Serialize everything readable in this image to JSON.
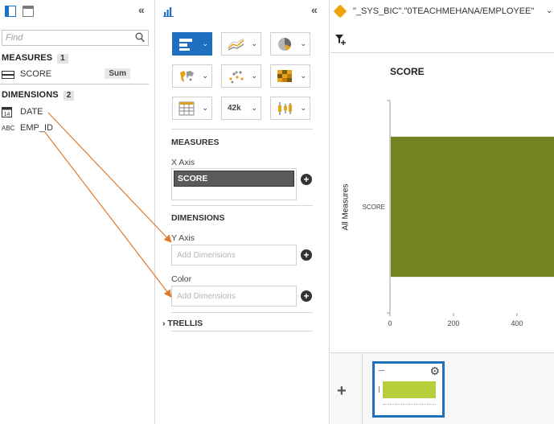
{
  "left_panel": {
    "find_placeholder": "Find",
    "measures_header": "MEASURES",
    "measures_count": "1",
    "measures": [
      {
        "label": "SCORE",
        "aggregation": "Sum",
        "icon": "measure-icon"
      }
    ],
    "dimensions_header": "DIMENSIONS",
    "dimensions_count": "2",
    "dimensions": [
      {
        "label": "DATE",
        "icon": "calendar-icon",
        "icon_text": "14"
      },
      {
        "label": "EMP_ID",
        "icon": "text-type-icon",
        "icon_text": "ABC"
      }
    ]
  },
  "mid_panel": {
    "chart_types": [
      {
        "name": "bar-chart",
        "selected": true
      },
      {
        "name": "line-chart"
      },
      {
        "name": "pie-chart"
      },
      {
        "name": "geo-map"
      },
      {
        "name": "scatter-plot"
      },
      {
        "name": "heat-map"
      },
      {
        "name": "table"
      },
      {
        "name": "numeric-point",
        "icon_text": "42k"
      },
      {
        "name": "box-plot"
      }
    ],
    "measures_header": "MEASURES",
    "x_axis_label": "X Axis",
    "x_axis_value": "SCORE",
    "dimensions_header": "DIMENSIONS",
    "y_axis_label": "Y Axis",
    "y_axis_placeholder": "Add Dimensions",
    "color_label": "Color",
    "color_placeholder": "Add Dimensions",
    "trellis_label": "TRELLIS"
  },
  "right_area": {
    "datasource_title": "\"_SYS_BIC\".\"0TEACHMEHANA/EMPLOYEE\"",
    "accent_color": "#1e6fbf",
    "bar_color": "#748322"
  },
  "chart_data": {
    "type": "bar",
    "title": "SCORE",
    "ylabel": "All Measures",
    "categories": [
      "SCORE"
    ],
    "x_ticks": [
      "0",
      "200",
      "400"
    ],
    "series": [
      {
        "values": [
          560
        ]
      }
    ],
    "xlim": [
      0,
      500
    ],
    "grid": false
  }
}
